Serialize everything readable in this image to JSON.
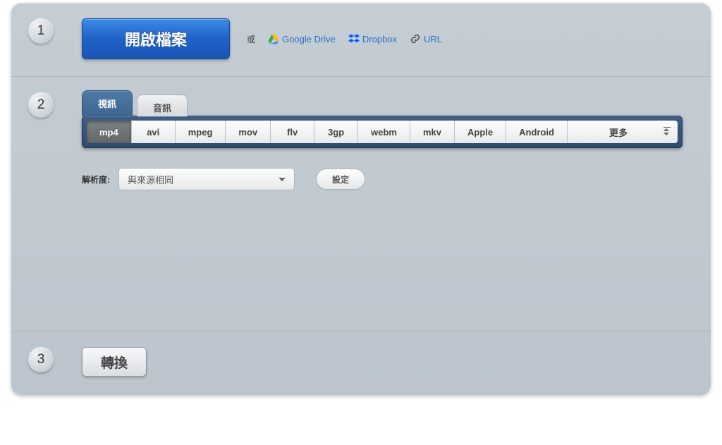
{
  "step1": {
    "num": "1",
    "open_label": "開啟檔案",
    "or_label": "或",
    "sources": {
      "gdrive": "Google Drive",
      "dropbox": "Dropbox",
      "url": "URL"
    }
  },
  "step2": {
    "num": "2",
    "tabs": {
      "video": "視訊",
      "audio": "音訊"
    },
    "formats": [
      "mp4",
      "avi",
      "mpeg",
      "mov",
      "flv",
      "3gp",
      "webm",
      "mkv",
      "Apple",
      "Android",
      "更多"
    ],
    "selected_format": "mp4",
    "resolution_label": "解析度:",
    "resolution_value": "與來源相同",
    "settings_label": "設定"
  },
  "step3": {
    "num": "3",
    "convert_label": "轉換"
  }
}
